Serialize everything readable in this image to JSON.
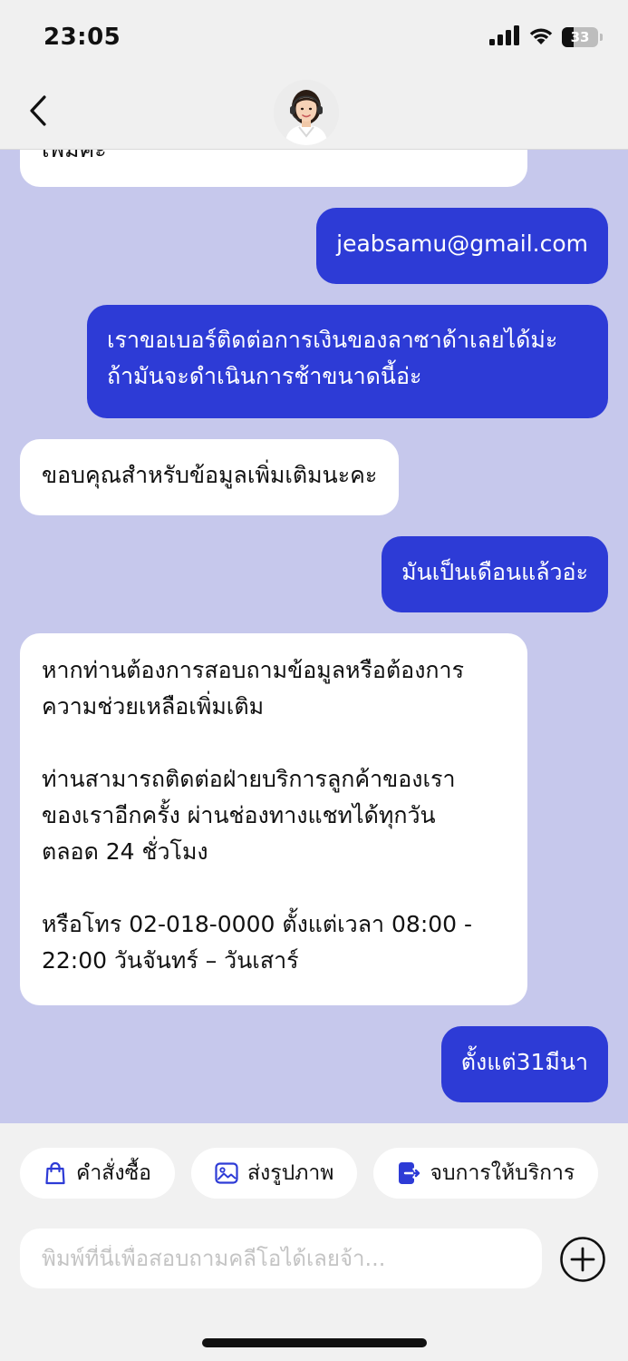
{
  "status_bar": {
    "time": "23:05",
    "battery_level": "33",
    "battery_fraction": 0.33,
    "icons": [
      "signal-icon",
      "wifi-icon",
      "battery-icon"
    ]
  },
  "header": {
    "back_icon": "chevron-left-icon",
    "avatar": "agent-avatar"
  },
  "messages": [
    {
      "side": "in",
      "text": "เพิ่มค่ะ"
    },
    {
      "side": "out",
      "text": "jeabsamu@gmail.com"
    },
    {
      "side": "out",
      "text": "เราขอเบอร์ติดต่อการเงินของลาซาด้าเลยได้ม่ะ\nถ้ามันจะดำเนินการช้าขนาดนี้อ่ะ"
    },
    {
      "side": "in",
      "text": "ขอบคุณสำหรับข้อมูลเพิ่มเติมนะคะ"
    },
    {
      "side": "out",
      "text": "มันเป็นเดือนแล้วอ่ะ"
    },
    {
      "side": "in",
      "text": "หากท่านต้องการสอบถามข้อมูลหรือต้องการ\nความช่วยเหลือเพิ่มเติม\n\nท่านสามารถติดต่อฝ่ายบริการลูกค้าของเรา\nของเราอีกครั้ง ผ่านช่องทางแชทได้ทุกวัน\nตลอด 24 ชั่วโมง\n\nหรือโทร 02-018-0000 ตั้งแต่เวลา 08:00 -\n22:00 วันจันทร์ – วันเสาร์"
    },
    {
      "side": "out",
      "text": "ตั้งแต่31มีนา"
    }
  ],
  "quick_actions": [
    {
      "label": "คำสั่งซื้อ",
      "icon": "shopping-bag-icon"
    },
    {
      "label": "ส่งรูปภาพ",
      "icon": "image-icon"
    },
    {
      "label": "จบการให้บริการ",
      "icon": "exit-icon"
    }
  ],
  "composer": {
    "placeholder": "พิมพ์ที่นี่เพื่อสอบถามคลีโอได้เลยจ้า...",
    "value": "",
    "add_icon": "plus-circle-icon"
  },
  "colors": {
    "chat_background": "#c6c8ec",
    "outgoing_bubble": "#2d3bd6",
    "incoming_bubble": "#ffffff",
    "icon_blue": "#2d3bd6"
  }
}
